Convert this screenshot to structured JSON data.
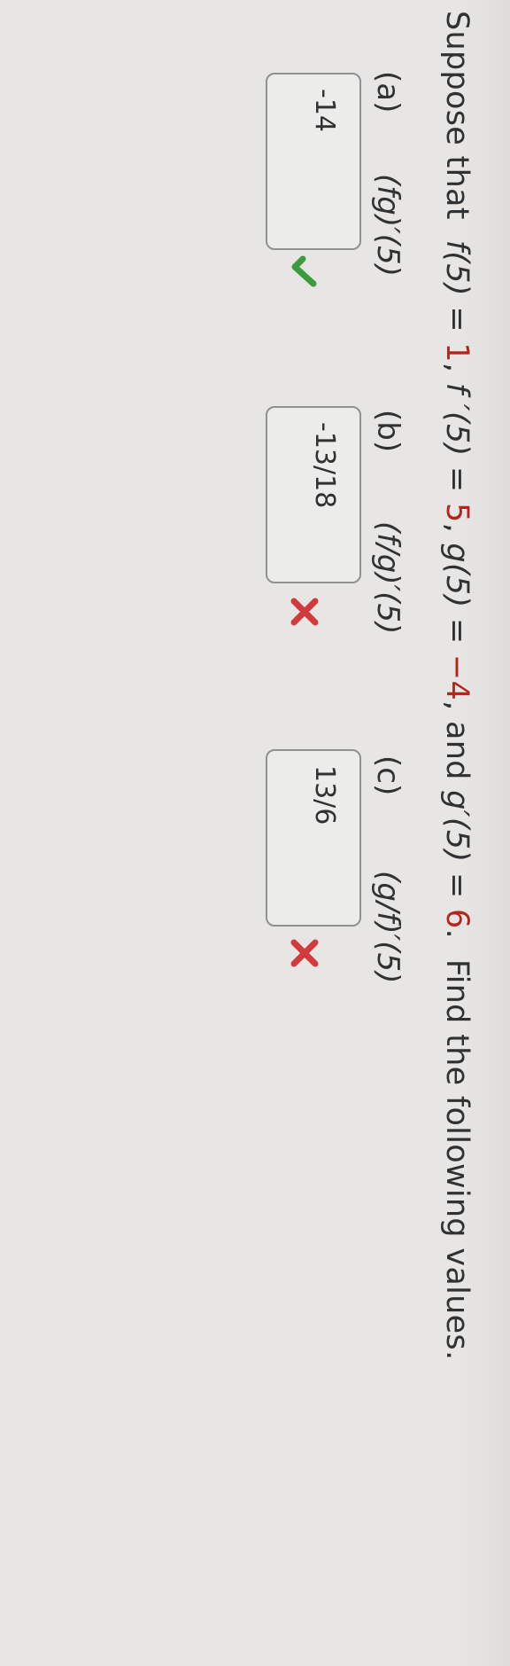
{
  "problem": {
    "intro": "Suppose that",
    "f5_lhs": "f(5) =",
    "f5_val": "1",
    "fp5_lhs": "f ′(5) =",
    "fp5_val": "5",
    "g5_lhs": "g(5) =",
    "g5_val": "−4",
    "and": "and",
    "gp5_lhs": "g′(5) =",
    "gp5_val": "6",
    "tail": "Find the following values."
  },
  "parts": [
    {
      "label": "(a)",
      "expr": "(fg)′(5)",
      "answer": "-14",
      "status": "correct"
    },
    {
      "label": "(b)",
      "expr": "(f/g)′(5)",
      "answer": "-13/18",
      "status": "incorrect"
    },
    {
      "label": "(c)",
      "expr": "(g/f)′(5)",
      "answer": "13/6",
      "status": "incorrect"
    }
  ],
  "colors": {
    "given_value": "#b3261e",
    "correct": "#3e9a3e",
    "incorrect": "#d23b3b"
  },
  "icons": {
    "correct": "check-icon",
    "incorrect": "x-icon"
  }
}
